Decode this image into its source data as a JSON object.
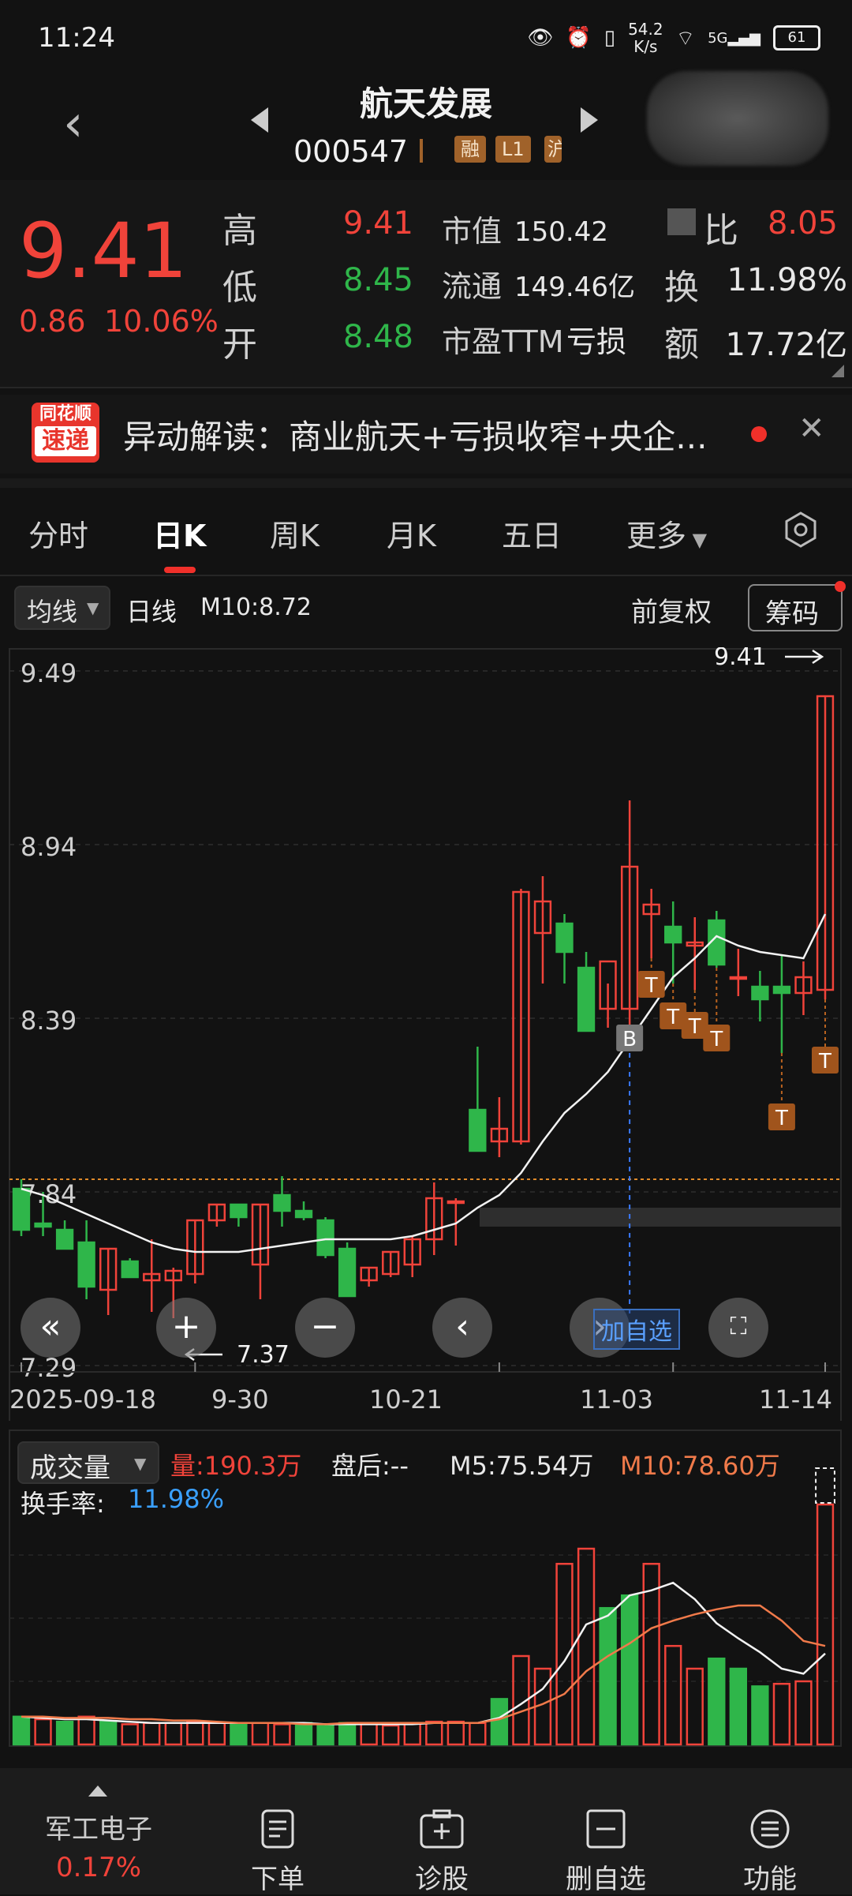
{
  "status": {
    "time": "11:24",
    "speed_top": "54.2",
    "speed_bottom": "K/s",
    "net": "5G",
    "battery": "61"
  },
  "header": {
    "title": "航天发展",
    "code": "000547",
    "tags": [
      "融",
      "L1",
      "沪"
    ]
  },
  "quote": {
    "price": "9.41",
    "change": "0.86",
    "change_pct": "10.06%",
    "high_label": "高",
    "high": "9.41",
    "low_label": "低",
    "low": "8.45",
    "open_label": "开",
    "open": "8.48",
    "mktcap_label": "市值",
    "mktcap": "150.42亿",
    "float_label": "流通",
    "float": "149.46亿",
    "pe_label": "市盈TTM",
    "pe": "亏损",
    "ratio_label": "比",
    "ratio": "8.05",
    "turnover_label": "换",
    "turnover": "11.98%",
    "amount_label": "额",
    "amount": "17.72亿"
  },
  "news": {
    "logo_line1": "同花顺",
    "logo_line2": "速递",
    "text": "异动解读：商业航天+亏损收窄+央企..."
  },
  "tabs": [
    "分时",
    "日K",
    "周K",
    "月K",
    "五日",
    "更多"
  ],
  "toolbar": {
    "ma_select": "均线",
    "period": "日线",
    "ma10": "M10:8.72",
    "adjust": "前复权",
    "chips": "筹码"
  },
  "chart_data": [
    {
      "type": "candlestick",
      "ylim": [
        7.29,
        9.49
      ],
      "y_ticks": [
        "9.49",
        "8.94",
        "8.39",
        "7.84",
        "7.29"
      ],
      "x_labels": [
        "2025-09-18",
        "9-30",
        "10-21",
        "11-03",
        "11-14"
      ],
      "last_price_label": "9.41",
      "low_marker_label": "7.37",
      "candles": [
        {
          "o": 7.85,
          "h": 7.88,
          "l": 7.7,
          "c": 7.72
        },
        {
          "o": 7.74,
          "h": 7.84,
          "l": 7.7,
          "c": 7.73
        },
        {
          "o": 7.72,
          "h": 7.75,
          "l": 7.66,
          "c": 7.66
        },
        {
          "o": 7.68,
          "h": 7.75,
          "l": 7.5,
          "c": 7.54
        },
        {
          "o": 7.53,
          "h": 7.66,
          "l": 7.45,
          "c": 7.66
        },
        {
          "o": 7.62,
          "h": 7.63,
          "l": 7.57,
          "c": 7.57
        },
        {
          "o": 7.56,
          "h": 7.69,
          "l": 7.46,
          "c": 7.58
        },
        {
          "o": 7.56,
          "h": 7.6,
          "l": 7.44,
          "c": 7.59
        },
        {
          "o": 7.58,
          "h": 7.75,
          "l": 7.55,
          "c": 7.75
        },
        {
          "o": 7.75,
          "h": 7.8,
          "l": 7.73,
          "c": 7.8
        },
        {
          "o": 7.8,
          "h": 7.8,
          "l": 7.73,
          "c": 7.76
        },
        {
          "o": 7.61,
          "h": 7.8,
          "l": 7.5,
          "c": 7.8
        },
        {
          "o": 7.83,
          "h": 7.89,
          "l": 7.73,
          "c": 7.78
        },
        {
          "o": 7.78,
          "h": 7.81,
          "l": 7.75,
          "c": 7.76
        },
        {
          "o": 7.75,
          "h": 7.76,
          "l": 7.63,
          "c": 7.64
        },
        {
          "o": 7.66,
          "h": 7.68,
          "l": 7.51,
          "c": 7.51
        },
        {
          "o": 7.56,
          "h": 7.6,
          "l": 7.54,
          "c": 7.6
        },
        {
          "o": 7.58,
          "h": 7.65,
          "l": 7.57,
          "c": 7.65
        },
        {
          "o": 7.61,
          "h": 7.7,
          "l": 7.57,
          "c": 7.69
        },
        {
          "o": 7.69,
          "h": 7.87,
          "l": 7.64,
          "c": 7.82
        },
        {
          "o": 7.81,
          "h": 7.82,
          "l": 7.67,
          "c": 7.81
        },
        {
          "o": 8.1,
          "h": 8.3,
          "l": 8.01,
          "c": 7.97
        },
        {
          "o": 8.0,
          "h": 8.14,
          "l": 7.95,
          "c": 8.04
        },
        {
          "o": 8.0,
          "h": 8.8,
          "l": 7.99,
          "c": 8.79
        },
        {
          "o": 8.66,
          "h": 8.84,
          "l": 8.5,
          "c": 8.76
        },
        {
          "o": 8.69,
          "h": 8.72,
          "l": 8.5,
          "c": 8.6
        },
        {
          "o": 8.55,
          "h": 8.6,
          "l": 8.35,
          "c": 8.35
        },
        {
          "o": 8.42,
          "h": 8.5,
          "l": 8.36,
          "c": 8.57
        },
        {
          "o": 8.42,
          "h": 9.08,
          "l": 8.33,
          "c": 8.87
        },
        {
          "o": 8.72,
          "h": 8.8,
          "l": 8.58,
          "c": 8.75
        },
        {
          "o": 8.68,
          "h": 8.76,
          "l": 8.5,
          "c": 8.63
        },
        {
          "o": 8.62,
          "h": 8.71,
          "l": 8.48,
          "c": 8.63
        },
        {
          "o": 8.7,
          "h": 8.73,
          "l": 8.55,
          "c": 8.56
        },
        {
          "o": 8.52,
          "h": 8.61,
          "l": 8.46,
          "c": 8.52
        },
        {
          "o": 8.49,
          "h": 8.54,
          "l": 8.38,
          "c": 8.45
        },
        {
          "o": 8.49,
          "h": 8.59,
          "l": 8.28,
          "c": 8.47
        },
        {
          "o": 8.47,
          "h": 8.57,
          "l": 8.4,
          "c": 8.52
        },
        {
          "o": 8.48,
          "h": 9.41,
          "l": 8.45,
          "c": 9.41
        }
      ],
      "ma10": [
        7.85,
        7.83,
        7.8,
        7.77,
        7.74,
        7.71,
        7.68,
        7.66,
        7.65,
        7.65,
        7.65,
        7.66,
        7.67,
        7.68,
        7.69,
        7.69,
        7.69,
        7.69,
        7.7,
        7.72,
        7.74,
        7.79,
        7.83,
        7.9,
        8.0,
        8.09,
        8.15,
        8.22,
        8.32,
        8.42,
        8.52,
        8.58,
        8.65,
        8.62,
        8.6,
        8.59,
        8.58,
        8.72
      ],
      "markers": [
        {
          "index": 28,
          "label": "B",
          "price": 8.33
        },
        {
          "index": 29,
          "label": "T",
          "price": 8.5
        },
        {
          "index": 30,
          "label": "T",
          "price": 8.4
        },
        {
          "index": 31,
          "label": "T",
          "price": 8.37
        },
        {
          "index": 32,
          "label": "T",
          "price": 8.33
        },
        {
          "index": 35,
          "label": "T",
          "price": 8.08
        },
        {
          "index": 37,
          "label": "T",
          "price": 8.26
        }
      ]
    },
    {
      "type": "bar",
      "title": "成交量",
      "volume_label": "量:190.3万",
      "after_hours": "盘后:--",
      "m5_label": "M5:75.54万",
      "m10_label": "M10:78.60万",
      "turnover_label": "换手率:",
      "turnover_value": "11.98%",
      "ylim": [
        0,
        200
      ],
      "values": [
        22,
        20,
        18,
        22,
        18,
        16,
        17,
        17,
        18,
        17,
        17,
        17,
        16,
        17,
        16,
        17,
        17,
        15,
        17,
        18,
        18,
        17,
        36,
        70,
        60,
        143,
        155,
        108,
        118,
        143,
        78,
        60,
        68,
        60,
        46,
        48,
        50,
        190
      ],
      "colors": [
        "g",
        "r",
        "g",
        "r",
        "g",
        "r",
        "r",
        "r",
        "r",
        "r",
        "g",
        "r",
        "r",
        "g",
        "g",
        "g",
        "r",
        "r",
        "r",
        "r",
        "r",
        "r",
        "g",
        "r",
        "r",
        "r",
        "r",
        "g",
        "g",
        "r",
        "r",
        "r",
        "g",
        "g",
        "g",
        "r",
        "r",
        "r"
      ],
      "m5": [
        22,
        21,
        20,
        20,
        19,
        18,
        17,
        17,
        17,
        17,
        17,
        17,
        17,
        17,
        16,
        16,
        16,
        16,
        16,
        17,
        17,
        17,
        21,
        32,
        44,
        66,
        95,
        102,
        118,
        122,
        128,
        115,
        96,
        84,
        73,
        60,
        56,
        72
      ],
      "m10": [
        22,
        22,
        21,
        21,
        21,
        20,
        20,
        19,
        19,
        18,
        17,
        17,
        17,
        16,
        16,
        17,
        17,
        17,
        17,
        17,
        17,
        17,
        20,
        26,
        32,
        40,
        58,
        70,
        80,
        92,
        98,
        103,
        107,
        110,
        110,
        98,
        82,
        78
      ]
    }
  ],
  "chart_controls": {
    "add_watch": "加自选"
  },
  "bottom_nav": {
    "sector_name": "军工电子",
    "sector_change": "0.17%",
    "items": [
      "下单",
      "诊股",
      "删自选",
      "功能"
    ]
  },
  "colors": {
    "up": "#f0433a",
    "down": "#2fb64a",
    "bg": "#121212",
    "tag": "#a0622a",
    "marker": "#a0541c",
    "m10_line": "#f07a4a"
  }
}
